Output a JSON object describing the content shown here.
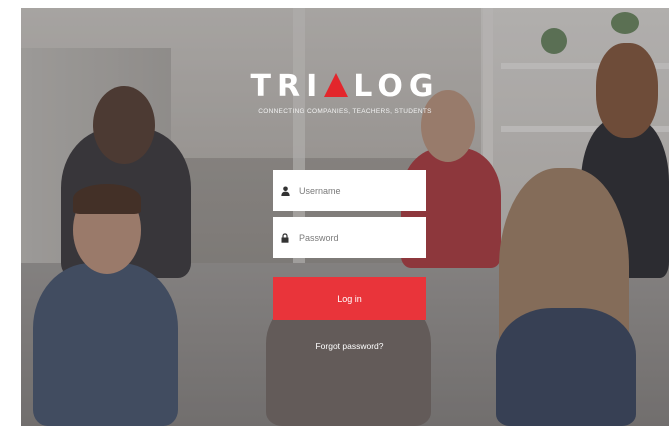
{
  "brand": {
    "logo_prefix": "TRI",
    "logo_suffix": "LOG",
    "logo_accent_shape": "red-triangle",
    "tagline": "CONNECTING COMPANIES, TEACHERS, STUDENTS",
    "accent_color": "#e9343a"
  },
  "login_form": {
    "username": {
      "placeholder": "Username",
      "value": "",
      "icon": "user-icon"
    },
    "password": {
      "placeholder": "Password",
      "value": "",
      "icon": "lock-icon"
    },
    "submit_label": "Log in",
    "forgot_password_label": "Forgot password?"
  }
}
